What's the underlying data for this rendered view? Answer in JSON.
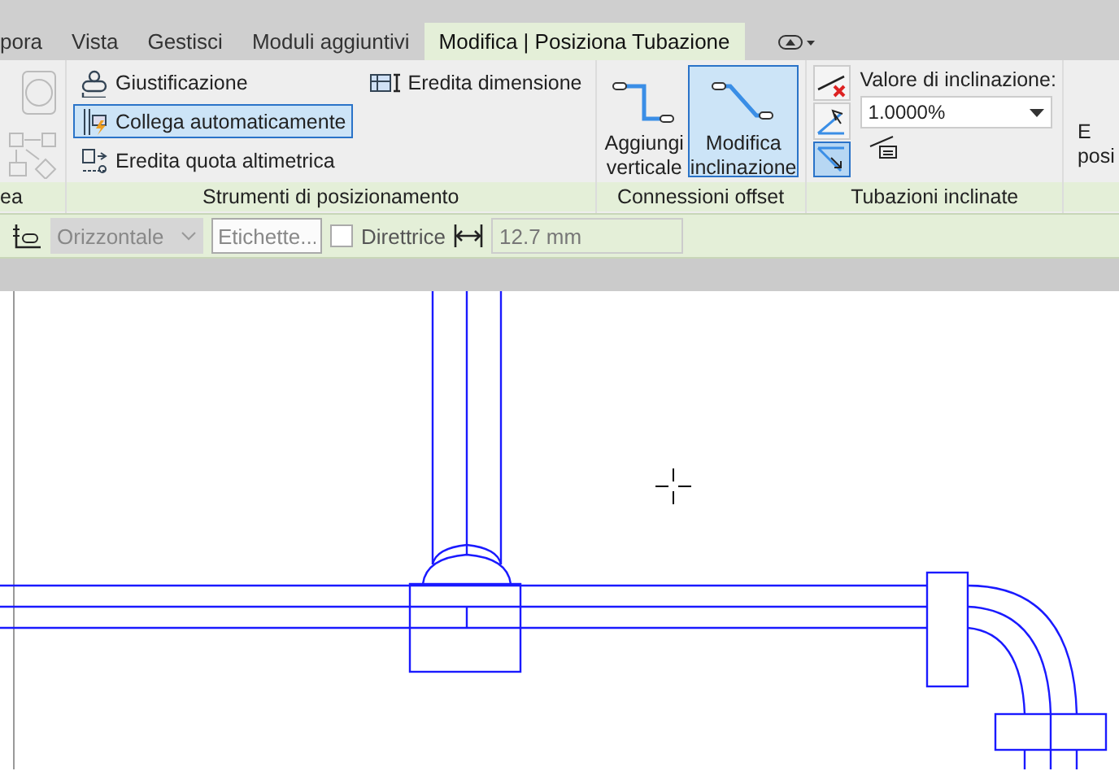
{
  "tabs": [
    {
      "label": "pora",
      "selected": false
    },
    {
      "label": "Vista",
      "selected": false
    },
    {
      "label": "Gestisci",
      "selected": false
    },
    {
      "label": "Moduli aggiuntivi",
      "selected": false
    },
    {
      "label": "Modifica | Posiziona Tubazione",
      "selected": true
    }
  ],
  "ribbon": {
    "left_panel": {
      "label": "ea"
    },
    "positioning_panel": {
      "label": "Strumenti di posizionamento",
      "tools": [
        {
          "kind": "justify",
          "label": "Giustificazione",
          "selected": false
        },
        {
          "kind": "autoconnect",
          "label": "Collega automaticamente",
          "selected": true
        },
        {
          "kind": "elevation",
          "label": "Eredita quota altimetrica",
          "selected": false
        }
      ],
      "inherit_size": "Eredita dimensione"
    },
    "offset_panel": {
      "label": "Connessioni offset",
      "buttons": [
        {
          "kind": "vertical",
          "label": "Aggiungi\nverticale",
          "selected": false
        },
        {
          "kind": "slope",
          "label": "Modifica\ninclinazione",
          "selected": true
        }
      ]
    },
    "slope_panel": {
      "label": "Tubazioni inclinate",
      "tools": [
        {
          "kind": "no-slope",
          "selected": false
        },
        {
          "kind": "slope-up",
          "selected": false
        },
        {
          "kind": "slope-down",
          "selected": true
        }
      ],
      "slope_label": "Valore di inclinazione:",
      "slope_value": "1.0000%"
    },
    "right_panel": {
      "texts": [
        "E",
        "posi"
      ]
    }
  },
  "options_bar": {
    "placement": "Orizzontale",
    "placement_disabled": true,
    "tag_placeholder": "Etichette...",
    "leader": {
      "label": "Direttrice",
      "checked": false
    },
    "diameter": "12.7 mm"
  }
}
